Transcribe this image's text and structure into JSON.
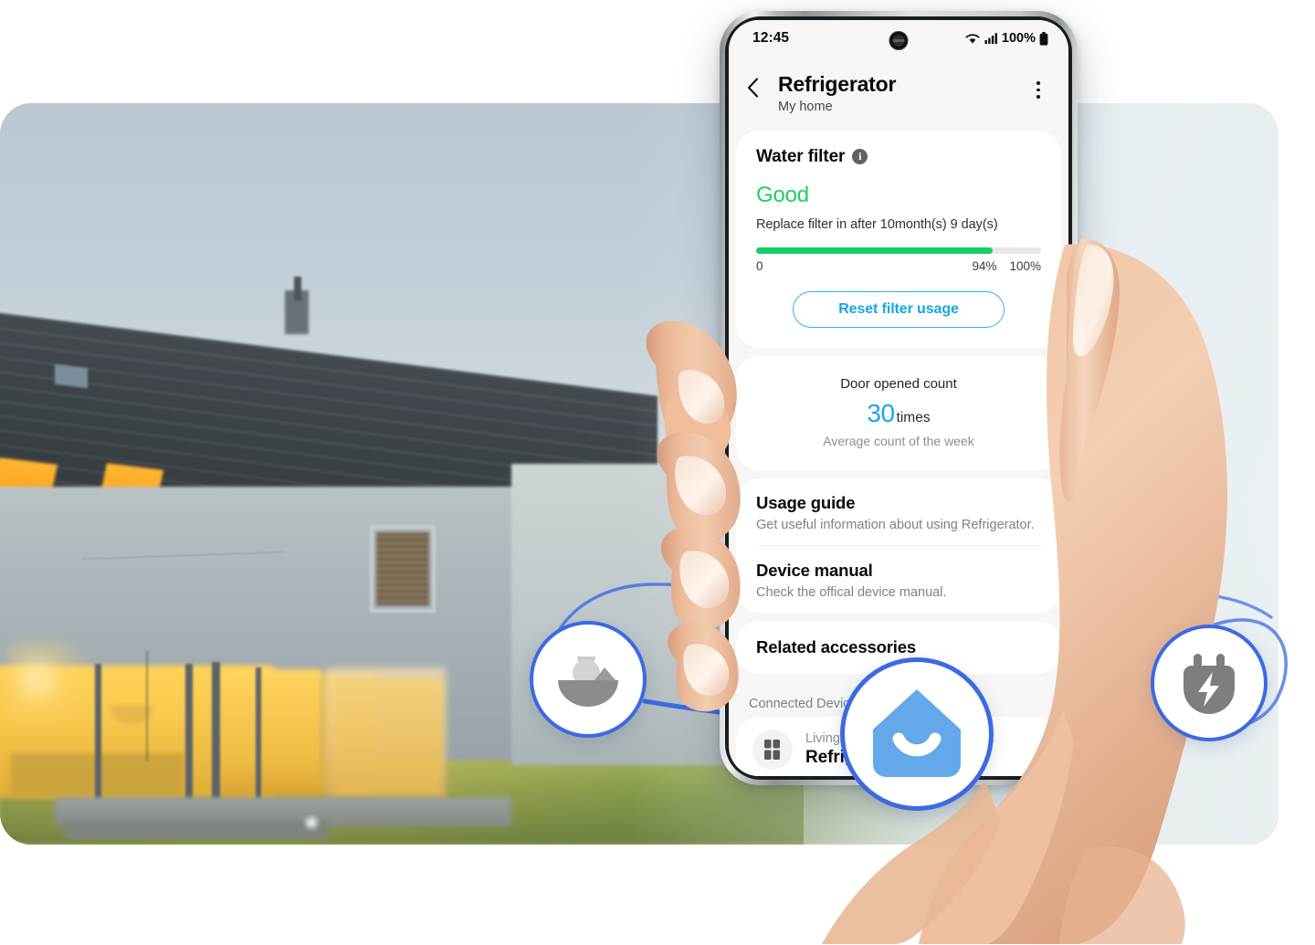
{
  "status_bar": {
    "time": "12:45",
    "battery_percent": "100%",
    "wifi_icon": "wifi-icon",
    "signal_icon": "cellular-signal-icon",
    "battery_icon": "battery-full-icon",
    "camera_icon": "front-camera-punch-hole"
  },
  "app_bar": {
    "back_icon": "chevron-left-icon",
    "title": "Refrigerator",
    "subtitle": "My home",
    "menu_icon": "more-options-icon"
  },
  "water_filter": {
    "title": "Water filter",
    "info_icon": "info-icon",
    "info_glyph": "i",
    "status": "Good",
    "status_color": "#1ed05e",
    "note": "Replace filter in after 10month(s) 9 day(s)",
    "progress_min_label": "0",
    "progress_value_label": "94%",
    "progress_max_label": "100%",
    "progress_percent": 83,
    "progress_fill_color": "#14cf63",
    "progress_track_color": "#e8e8e8",
    "reset_button": "Reset filter usage",
    "reset_button_color": "#16a7e0"
  },
  "door_count": {
    "title": "Door opened count",
    "value": "30",
    "unit": "times",
    "subtitle": "Average count of the week",
    "value_color": "#1aa7e8"
  },
  "info_rows": [
    {
      "title": "Usage guide",
      "subtitle": "Get useful information about using Refrigerator."
    },
    {
      "title": "Device manual",
      "subtitle": "Check the offical device manual."
    }
  ],
  "related_accessories": {
    "title": "Related accessories",
    "connected_label": "Connected Devices"
  },
  "device_item": {
    "icon": "refrigerator-icon",
    "room": "Living",
    "name": "Refrigerator"
  },
  "badges": [
    {
      "id": "food-bowl-badge",
      "icon": "food-bowl-icon",
      "ring_color": "#3b6ae2"
    },
    {
      "id": "home-badge",
      "icon": "smartthings-home-icon",
      "ring_color": "#3b6ae2",
      "fill_color": "#63a8e8"
    },
    {
      "id": "power-plug-badge",
      "icon": "power-plug-bolt-icon",
      "ring_color": "#3b6ae2"
    }
  ],
  "scene": {
    "photo": "modern-house-at-dusk-with-lit-windows-and-lawn",
    "hand": "hand-holding-smartphone"
  },
  "theme": {
    "accent_blue": "#3b6ae2",
    "link_blue": "#16a7e0",
    "good_green": "#14cf63",
    "screen_bg": "#f6f6f6",
    "card_bg": "#ffffff"
  }
}
